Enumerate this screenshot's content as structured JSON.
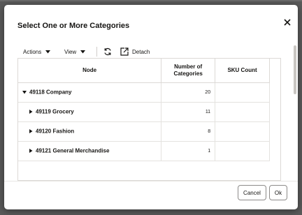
{
  "dialog": {
    "title": "Select One or More Categories",
    "close_icon": "close-icon"
  },
  "toolbar": {
    "actions_label": "Actions",
    "view_label": "View",
    "refresh_icon": "refresh-icon",
    "detach_icon": "detach-icon",
    "detach_label": "Detach"
  },
  "table": {
    "columns": [
      "Node",
      "Number of Categories",
      "SKU Count"
    ],
    "rows": [
      {
        "node": "49118 Company",
        "expanded": true,
        "level": 0,
        "count": "20",
        "sku": ""
      },
      {
        "node": "49119 Grocery",
        "expanded": false,
        "level": 1,
        "count": "11",
        "sku": ""
      },
      {
        "node": "49120 Fashion",
        "expanded": false,
        "level": 1,
        "count": "8",
        "sku": ""
      },
      {
        "node": "49121 General Merchandise",
        "expanded": false,
        "level": 1,
        "count": "1",
        "sku": ""
      }
    ]
  },
  "buttons": {
    "cancel": "Cancel",
    "ok": "Ok"
  },
  "colors": {
    "backdrop": "#5a5a5a",
    "border": "#dcd9d6",
    "text": "#161513"
  }
}
